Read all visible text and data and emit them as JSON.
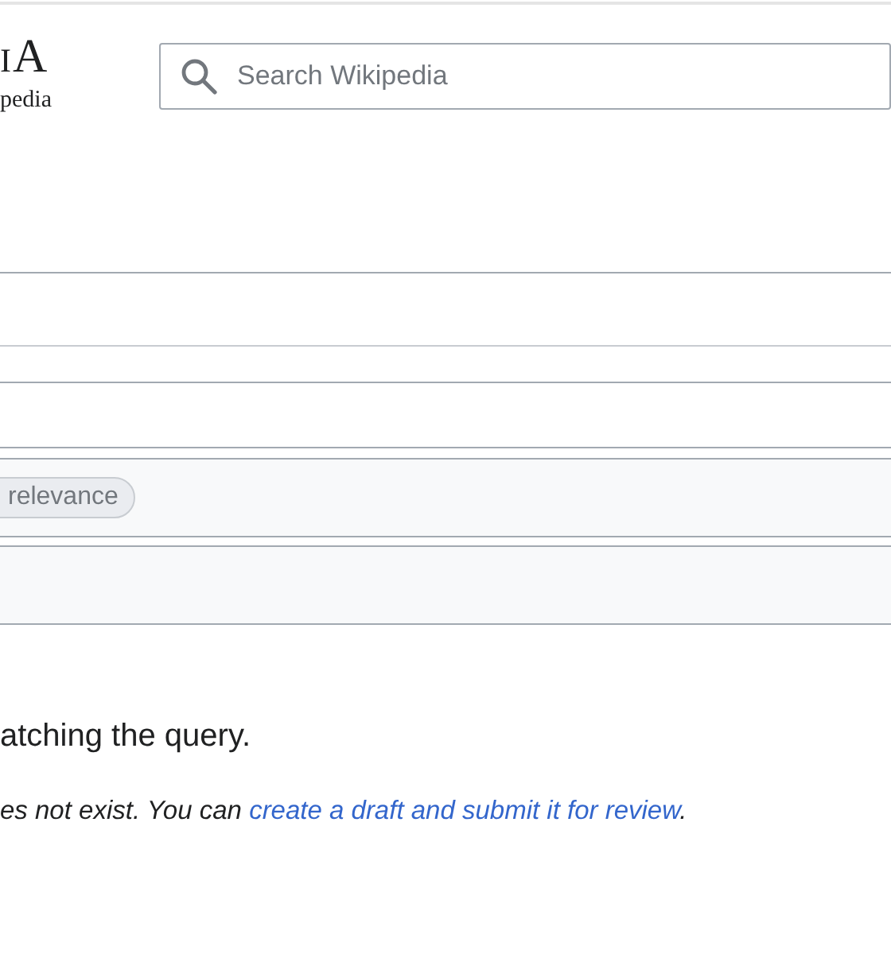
{
  "header": {
    "logo_wordmark": "iA",
    "logo_tagline": "pedia",
    "search": {
      "placeholder": "Search Wikipedia"
    }
  },
  "search_form": {
    "sort_chip": "relevance"
  },
  "results": {
    "info": "atching the query.",
    "notice_before": "es not exist. You can ",
    "notice_link": "create a draft and submit it for review",
    "notice_after": "."
  }
}
